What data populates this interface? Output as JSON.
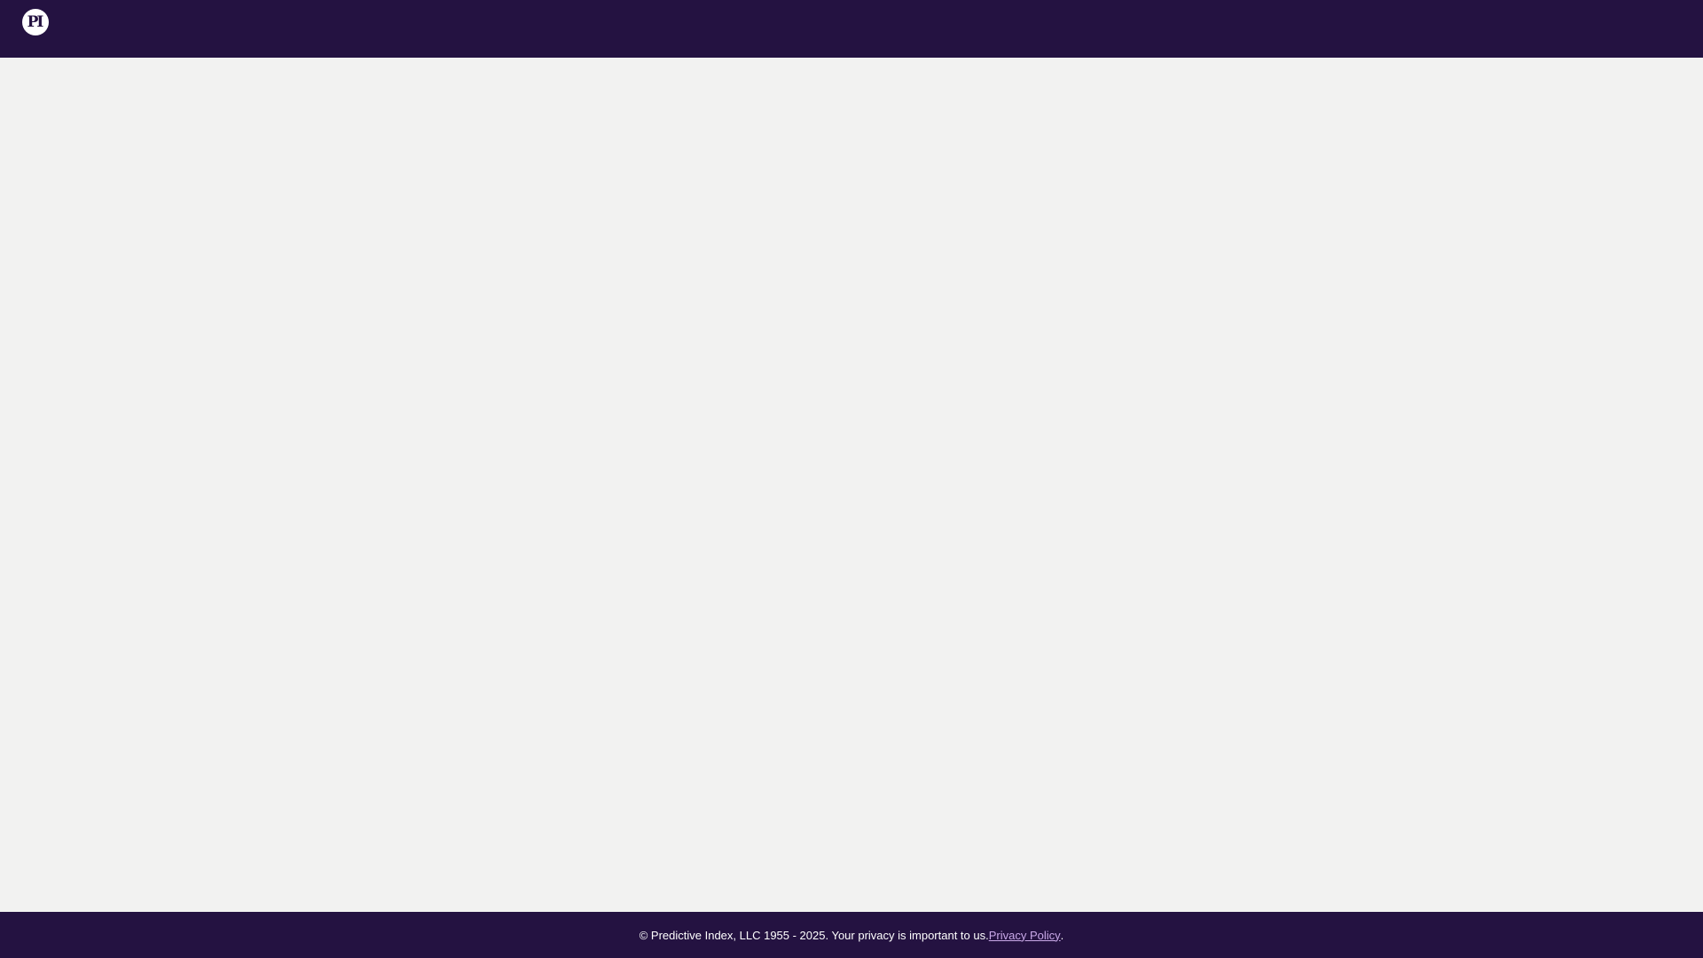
{
  "header": {
    "logo_text": "PI"
  },
  "footer": {
    "copyright_text": "© Predictive Index, LLC 1955 - 2025. Your privacy is important to us. ",
    "privacy_link_label": "Privacy Policy",
    "trailing_period": "."
  },
  "colors": {
    "brand_dark": "#241241",
    "background": "#f2f2f1",
    "link": "#c9a8e8"
  },
  "icons": {
    "logo": "predictive-index-logo-icon"
  }
}
